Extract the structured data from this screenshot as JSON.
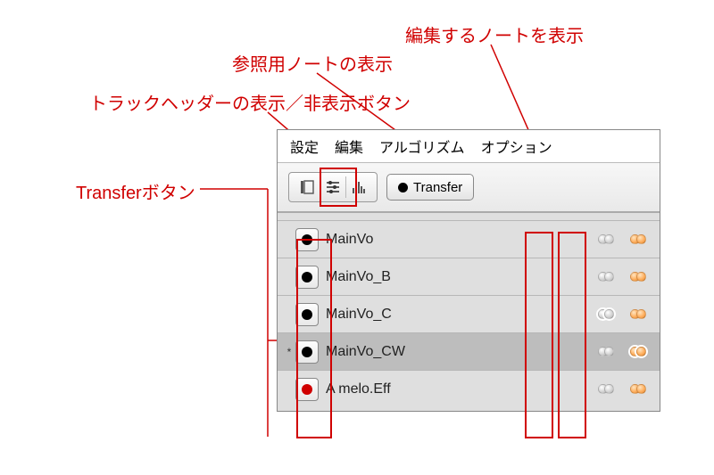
{
  "annotations": {
    "edit_notes": "編集するノートを表示",
    "ref_notes": "参照用ノートの表示",
    "track_header_toggle": "トラックヘッダーの表示／非表示ボタン",
    "transfer_button": "Transferボタン"
  },
  "menubar": {
    "settings": "設定",
    "edit": "編集",
    "algorithm": "アルゴリズム",
    "option": "オプション"
  },
  "toolbar": {
    "transfer_label": "Transfer"
  },
  "tracks": [
    {
      "name": "MainVo",
      "starred": false,
      "armed": false,
      "selected": false,
      "ref_outlined": false,
      "edit_outlined": false
    },
    {
      "name": "MainVo_B",
      "starred": false,
      "armed": false,
      "selected": false,
      "ref_outlined": false,
      "edit_outlined": false
    },
    {
      "name": "MainVo_C",
      "starred": false,
      "armed": false,
      "selected": false,
      "ref_outlined": true,
      "edit_outlined": false
    },
    {
      "name": "MainVo_CW",
      "starred": true,
      "armed": false,
      "selected": true,
      "ref_outlined": false,
      "edit_outlined": true
    },
    {
      "name": "A melo.Eff",
      "starred": false,
      "armed": true,
      "selected": false,
      "ref_outlined": false,
      "edit_outlined": false
    }
  ]
}
